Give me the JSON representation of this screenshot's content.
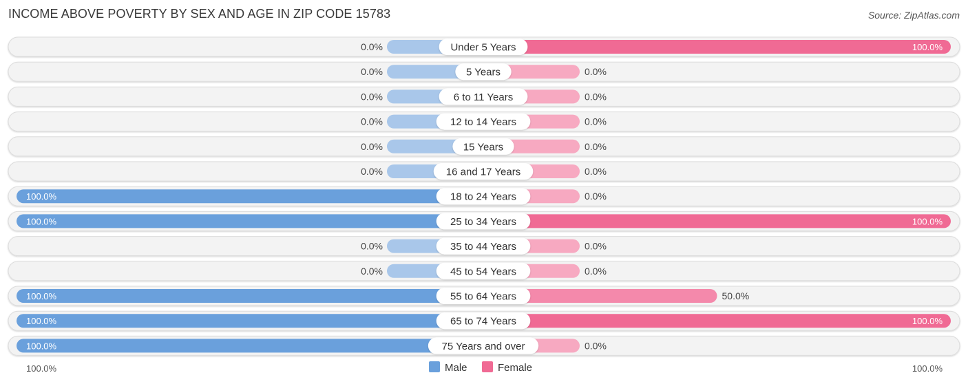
{
  "title": "INCOME ABOVE POVERTY BY SEX AND AGE IN ZIP CODE 15783",
  "source": "Source: ZipAtlas.com",
  "colors": {
    "male_strong": "#6aa0dc",
    "male_light": "#a9c7ea",
    "female_strong": "#f06a94",
    "female_light": "#f7a9c1",
    "row_bg": "#f3f3f3"
  },
  "legend": [
    {
      "name": "Male",
      "color": "#6aa0dc"
    },
    {
      "name": "Female",
      "color": "#f06a94"
    }
  ],
  "axis": {
    "left_label": "100.0%",
    "right_label": "100.0%"
  },
  "chart_data": {
    "type": "bar",
    "orientation": "horizontal-diverging",
    "title": "INCOME ABOVE POVERTY BY SEX AND AGE IN ZIP CODE 15783",
    "categories": [
      "Under 5 Years",
      "5 Years",
      "6 to 11 Years",
      "12 to 14 Years",
      "15 Years",
      "16 and 17 Years",
      "18 to 24 Years",
      "25 to 34 Years",
      "35 to 44 Years",
      "45 to 54 Years",
      "55 to 64 Years",
      "65 to 74 Years",
      "75 Years and over"
    ],
    "series": [
      {
        "name": "Male",
        "values": [
          0,
          0,
          0,
          0,
          0,
          0,
          100,
          100,
          0,
          0,
          100,
          100,
          100
        ],
        "labels": [
          "0.0%",
          "0.0%",
          "0.0%",
          "0.0%",
          "0.0%",
          "0.0%",
          "100.0%",
          "100.0%",
          "0.0%",
          "0.0%",
          "100.0%",
          "100.0%",
          "100.0%"
        ]
      },
      {
        "name": "Female",
        "values": [
          100,
          0,
          0,
          0,
          0,
          0,
          0,
          100,
          0,
          0,
          50,
          100,
          0
        ],
        "labels": [
          "100.0%",
          "0.0%",
          "0.0%",
          "0.0%",
          "0.0%",
          "0.0%",
          "0.0%",
          "100.0%",
          "0.0%",
          "0.0%",
          "50.0%",
          "100.0%",
          "0.0%"
        ]
      }
    ],
    "xlim": [
      0,
      100
    ],
    "xlabel_left": "100.0%",
    "xlabel_right": "100.0%",
    "legend_position": "bottom-center",
    "grid": false
  }
}
